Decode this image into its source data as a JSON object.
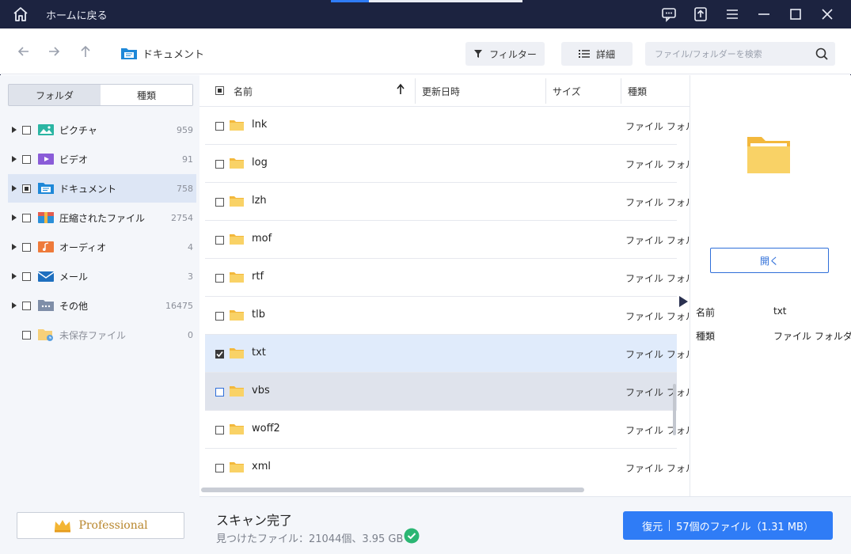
{
  "titlebar": {
    "home_label": "ホームに戻る",
    "icons": [
      "home-icon",
      "feedback-icon",
      "upload-icon",
      "menu-icon",
      "minimize-icon",
      "maximize-icon",
      "close-icon"
    ]
  },
  "toolbar": {
    "breadcrumb": "ドキュメント",
    "filter_label": "フィルター",
    "detail_label": "詳細",
    "search_placeholder": "ファイル/フォルダーを検索"
  },
  "left": {
    "tabs": [
      {
        "label": "フォルダ",
        "active": false
      },
      {
        "label": "種類",
        "active": true
      }
    ],
    "categories": [
      {
        "label": "ピクチャ",
        "count": "959",
        "icon": "picture-icon"
      },
      {
        "label": "ビデオ",
        "count": "91",
        "icon": "video-icon"
      },
      {
        "label": "ドキュメント",
        "count": "758",
        "icon": "document-icon",
        "selected": true
      },
      {
        "label": "圧縮されたファイル",
        "count": "2754",
        "icon": "archive-icon"
      },
      {
        "label": "オーディオ",
        "count": "4",
        "icon": "audio-icon"
      },
      {
        "label": "メール",
        "count": "3",
        "icon": "mail-icon"
      },
      {
        "label": "その他",
        "count": "16475",
        "icon": "other-icon"
      },
      {
        "label": "未保存ファイル",
        "count": "0",
        "icon": "unsaved-icon"
      }
    ],
    "pro_label": "Professional"
  },
  "list": {
    "headers": {
      "name": "名前",
      "modified": "更新日時",
      "size": "サイズ",
      "type": "種類"
    },
    "rows": [
      {
        "name": "lnk",
        "type": "ファイル フォルダー"
      },
      {
        "name": "log",
        "type": "ファイル フォルダー"
      },
      {
        "name": "lzh",
        "type": "ファイル フォルダー"
      },
      {
        "name": "mof",
        "type": "ファイル フォルダー"
      },
      {
        "name": "rtf",
        "type": "ファイル フォルダー"
      },
      {
        "name": "tlb",
        "type": "ファイル フォルダー"
      },
      {
        "name": "txt",
        "type": "ファイル フォルダー",
        "checked": true
      },
      {
        "name": "vbs",
        "type": "ファイル フォルダー",
        "hover": true
      },
      {
        "name": "woff2",
        "type": "ファイル フォルダー"
      },
      {
        "name": "xml",
        "type": "ファイル フォルダー"
      }
    ]
  },
  "preview": {
    "open_label": "開く",
    "props": [
      {
        "key": "名前",
        "value": "txt"
      },
      {
        "key": "種類",
        "value": "ファイル フォルダー"
      }
    ]
  },
  "status": {
    "title": "スキャン完了",
    "found": "見つけたファイル：21044個、3.95 GB",
    "recover_label": "復元",
    "recover_detail": "57個のファイル（1.31 MB）"
  },
  "colors": {
    "titlebar": "#1c2340",
    "accent": "#2f7cf6",
    "folder": "#f6c343"
  }
}
